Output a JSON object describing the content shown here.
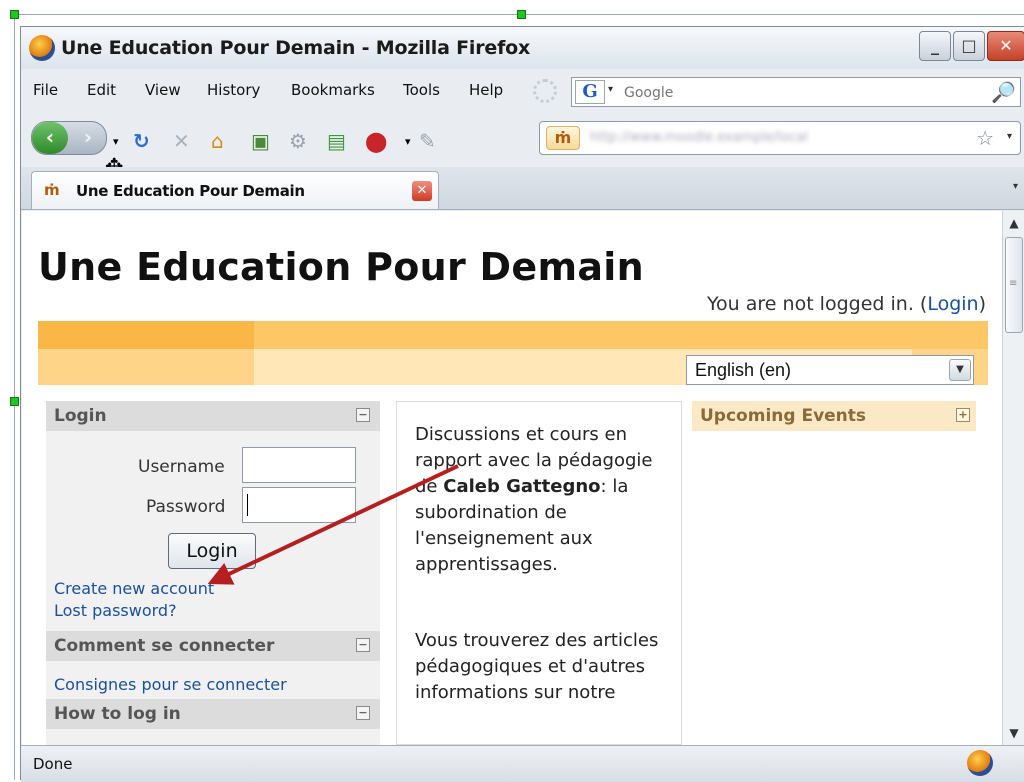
{
  "window": {
    "title": "Une Education Pour Demain - Mozilla Firefox",
    "minimize": "_",
    "maximize": "□",
    "close": "✕"
  },
  "menubar": {
    "items": [
      "File",
      "Edit",
      "View",
      "History",
      "Bookmarks",
      "Tools",
      "Help"
    ]
  },
  "search": {
    "engine": "G",
    "placeholder": "Google",
    "go_glyph": "🔎"
  },
  "navigation": {
    "back_glyph": "‹",
    "forward_glyph": "›",
    "favicon_text": "ṁ",
    "url": "http://www.moodle.example/local"
  },
  "tab": {
    "favicon_text": "ṁ",
    "label": "Une Education Pour Demain",
    "close_glyph": "✕"
  },
  "page": {
    "title": "Une Education Pour Demain",
    "login_status_prefix": "You are not logged in. (",
    "login_link": "Login",
    "login_status_suffix": ")",
    "language_selected": "English (en)"
  },
  "login_block": {
    "header": "Login",
    "username_label": "Username",
    "password_label": "Password",
    "button": "Login",
    "create_account": "Create new account",
    "lost_password": "Lost password?"
  },
  "comment_block": {
    "header": "Comment se connecter",
    "link": "Consignes pour se connecter"
  },
  "howto_block": {
    "header": "How to log in"
  },
  "block_controls": {
    "collapse": "−",
    "expand": "+"
  },
  "main_text": {
    "p1_before": "Discussions et cours en rapport avec la pédagogie de ",
    "p1_bold": "Caleb Gattegno",
    "p1_after": ": la subordination de l'enseignement aux apprentissages.",
    "p2": "Vous trouverez des articles pédagogiques et d'autres informations sur notre"
  },
  "upcoming": {
    "header": "Upcoming Events"
  },
  "status": {
    "text": "Done"
  },
  "colors": {
    "annotation_arrow": "#b51f1f",
    "link": "#1a4f9c",
    "band_dark": "#fbb648",
    "band_light": "#ffe7b8"
  }
}
